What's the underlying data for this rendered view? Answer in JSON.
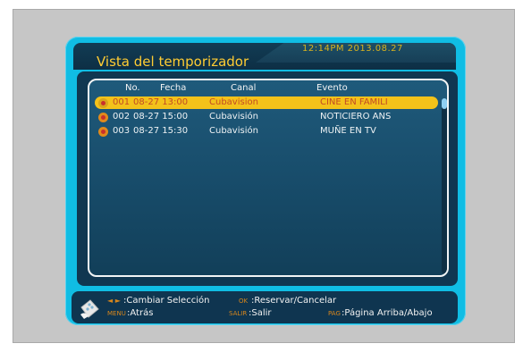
{
  "header": {
    "clock": "12:14PM  2013.08.27",
    "title": "Vista del temporizador"
  },
  "list": {
    "columns": [
      "No.",
      "Fecha",
      "Canal",
      "Evento"
    ],
    "rows": [
      {
        "no": "001",
        "date": "08-27 13:00",
        "channel": "Cubavision",
        "event": "CINE EN FAMILI"
      },
      {
        "no": "002",
        "date": "08-27 15:00",
        "channel": "Cubavisión",
        "event": "NOTICIERO ANS"
      },
      {
        "no": "003",
        "date": "08-27 15:30",
        "channel": "Cubavisión",
        "event": "MUÑE EN TV"
      }
    ],
    "selected_index": 0
  },
  "help": {
    "arrows_key": "◄ ►",
    "arrows_label": ":Cambiar Selección",
    "ok_key": "OK",
    "ok_label": ":Reservar/Cancelar",
    "menu_key": "MENU",
    "menu_label": ":Atrás",
    "exit_key": "SALIR",
    "exit_label": ":Salir",
    "page_key": "PAG",
    "page_label": ":Página Arriba/Abajo"
  },
  "icons": {
    "row_icon": "timer-icon",
    "help_icon": "remote-control-icon"
  },
  "colors": {
    "accent": "#10bde4",
    "title": "#ffcc33",
    "selection": "#f3c21a",
    "panel": "#103751"
  }
}
